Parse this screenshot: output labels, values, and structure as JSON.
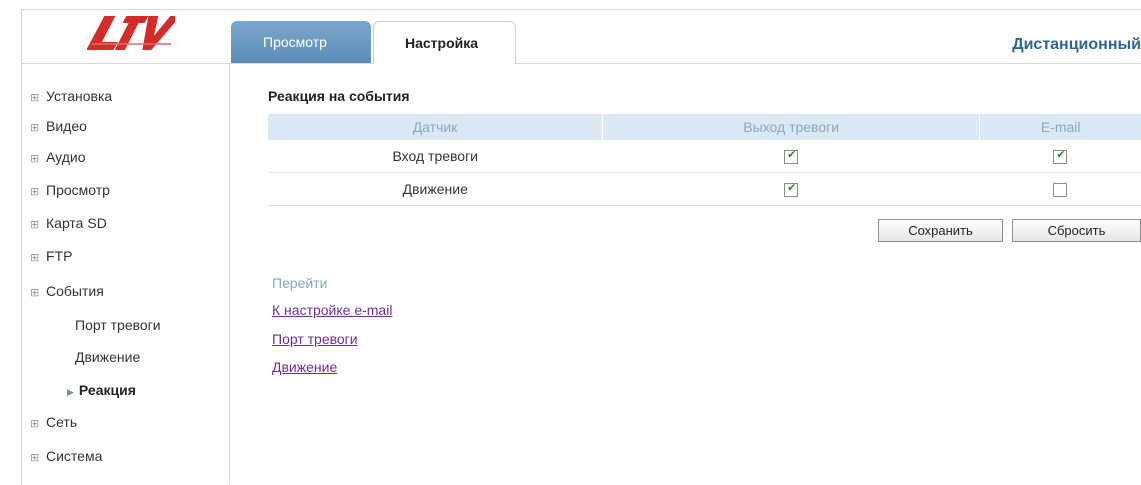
{
  "logo": {
    "text": "LTV",
    "color": "#d42b2b"
  },
  "tabs": {
    "view_label": "Просмотр",
    "setup_label": "Настройка"
  },
  "remote_title": "Дистанционный",
  "sidebar": {
    "items": [
      {
        "label": "Установка"
      },
      {
        "label": "Видео"
      },
      {
        "label": "Аудио"
      },
      {
        "label": "Просмотр"
      },
      {
        "label": "Карта SD"
      },
      {
        "label": "FTP"
      },
      {
        "label": "События"
      },
      {
        "label": "Сеть"
      },
      {
        "label": "Система"
      }
    ],
    "subitems": [
      {
        "label": "Порт тревоги",
        "active": false
      },
      {
        "label": "Движение",
        "active": false
      },
      {
        "label": "Реакция",
        "active": true
      }
    ]
  },
  "main": {
    "section_title": "Реакция на события",
    "table": {
      "headers": [
        "Датчик",
        "Выход тревоги",
        "E-mail"
      ],
      "rows": [
        {
          "sensor": "Вход тревоги",
          "alarm_out": true,
          "email": true
        },
        {
          "sensor": "Движение",
          "alarm_out": true,
          "email": false
        }
      ]
    },
    "buttons": {
      "save_label": "Сохранить",
      "reset_label": "Сбросить"
    },
    "goto": {
      "label": "Перейти",
      "links": [
        "К настройке e-mail",
        "Порт тревоги",
        "Движение"
      ]
    }
  },
  "colors": {
    "accent": "#2f6592",
    "tab_active_bg": "#6a98c0",
    "table_header_bg": "#dbe9f4",
    "link": "#6e2f8f"
  }
}
